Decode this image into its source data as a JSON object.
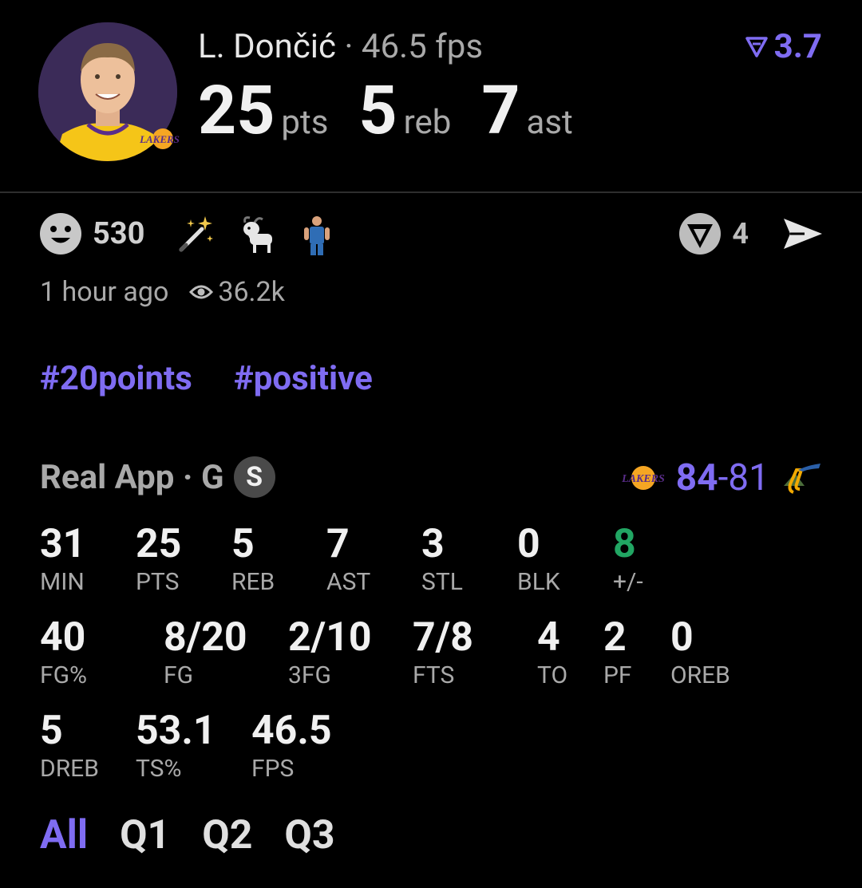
{
  "player": {
    "name": "L. Dončić",
    "separator": "·",
    "fps": "46.5 fps",
    "rating": "3.7"
  },
  "headline": [
    {
      "value": "25",
      "unit": "pts"
    },
    {
      "value": "5",
      "unit": "reb"
    },
    {
      "value": "7",
      "unit": "ast"
    }
  ],
  "reactions": {
    "count": "530",
    "icons": [
      "smile-icon",
      "magic-wand-icon",
      "goat-icon",
      "player-sticker-icon"
    ],
    "right_count": "4"
  },
  "meta": {
    "time": "1 hour ago",
    "views": "36.2k"
  },
  "tags": [
    "#20points",
    "#positive"
  ],
  "boxscore": {
    "source": "Real App · G",
    "badge": "S",
    "score_home": "84",
    "score_dash": "-",
    "score_away": "81"
  },
  "stats": {
    "row1": [
      {
        "value": "31",
        "label": "MIN"
      },
      {
        "value": "25",
        "label": "PTS"
      },
      {
        "value": "5",
        "label": "REB"
      },
      {
        "value": "7",
        "label": "AST"
      },
      {
        "value": "3",
        "label": "STL"
      },
      {
        "value": "0",
        "label": "BLK"
      },
      {
        "value": "8",
        "label": "+/-"
      }
    ],
    "row2": [
      {
        "value": "40",
        "label": "FG%"
      },
      {
        "value": "8/20",
        "label": "FG"
      },
      {
        "value": "2/10",
        "label": "3FG"
      },
      {
        "value": "7/8",
        "label": "FTS"
      },
      {
        "value": "4",
        "label": "TO"
      },
      {
        "value": "2",
        "label": "PF"
      },
      {
        "value": "0",
        "label": "OREB"
      }
    ],
    "row3": [
      {
        "value": "5",
        "label": "DREB"
      },
      {
        "value": "53.1",
        "label": "TS%"
      },
      {
        "value": "46.5",
        "label": "FPS"
      }
    ]
  },
  "quarters": [
    "All",
    "Q1",
    "Q2",
    "Q3"
  ],
  "colors": {
    "accent": "#7f6cf2",
    "positive": "#21a663",
    "background": "#000000"
  }
}
